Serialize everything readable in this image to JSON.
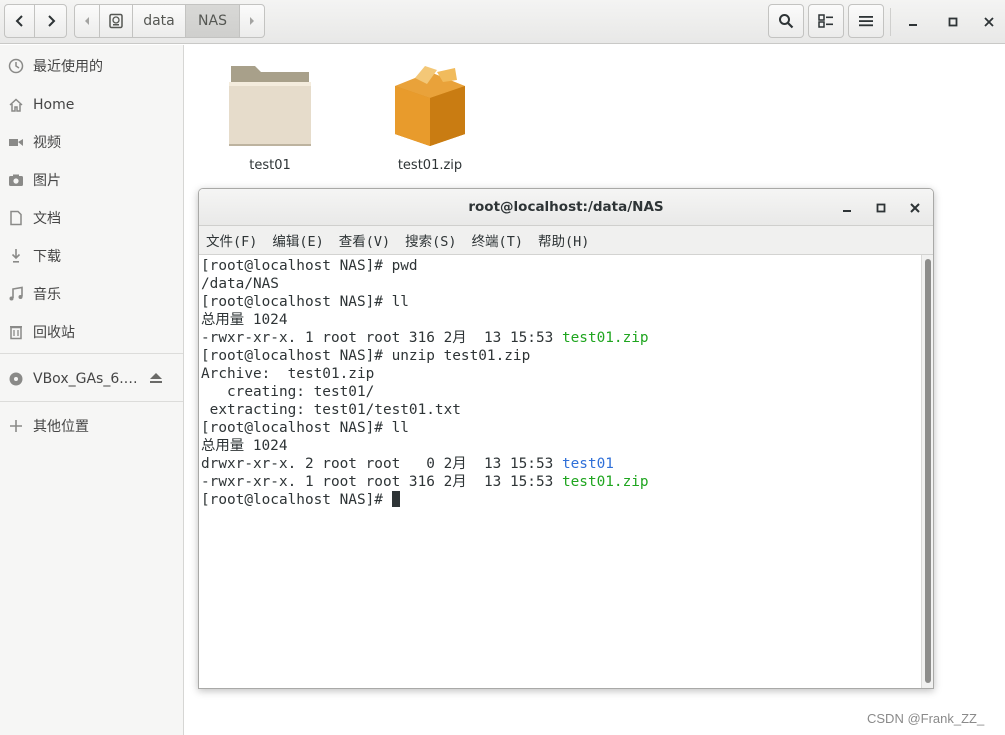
{
  "header": {
    "path_root_icon": "drive-icon",
    "path_segments": [
      "data",
      "NAS"
    ]
  },
  "sidebar": {
    "items": [
      {
        "icon": "clock-icon",
        "label": "最近使用的"
      },
      {
        "icon": "home-icon",
        "label": "Home"
      },
      {
        "icon": "video-icon",
        "label": "视频"
      },
      {
        "icon": "camera-icon",
        "label": "图片"
      },
      {
        "icon": "document-icon",
        "label": "文档"
      },
      {
        "icon": "download-icon",
        "label": "下载"
      },
      {
        "icon": "music-icon",
        "label": "音乐"
      },
      {
        "icon": "trash-icon",
        "label": "回收站"
      },
      {
        "icon": "disc-icon",
        "label": "VBox_GAs_6.…"
      },
      {
        "icon": "plus-icon",
        "label": "其他位置"
      }
    ]
  },
  "files": [
    {
      "name": "test01",
      "icon": "folder-icon"
    },
    {
      "name": "test01.zip",
      "icon": "package-icon"
    }
  ],
  "terminal": {
    "title": "root@localhost:/data/NAS",
    "menu": [
      "文件(F)",
      "编辑(E)",
      "查看(V)",
      "搜索(S)",
      "终端(T)",
      "帮助(H)"
    ],
    "lines": [
      {
        "text": "[root@localhost NAS]# pwd",
        "hl": ""
      },
      {
        "text": "/data/NAS",
        "hl": ""
      },
      {
        "text": "[root@localhost NAS]# ll",
        "hl": ""
      },
      {
        "text": "总用量 1024",
        "hl": ""
      },
      {
        "text": "-rwxr-xr-x. 1 root root 316 2月  13 15:53 ",
        "hl": "test01.zip",
        "hl_color": "green"
      },
      {
        "text": "[root@localhost NAS]# unzip test01.zip",
        "hl": ""
      },
      {
        "text": "Archive:  test01.zip",
        "hl": ""
      },
      {
        "text": "   creating: test01/",
        "hl": ""
      },
      {
        "text": " extracting: test01/test01.txt",
        "hl": ""
      },
      {
        "text": "[root@localhost NAS]# ll",
        "hl": ""
      },
      {
        "text": "总用量 1024",
        "hl": ""
      },
      {
        "text": "drwxr-xr-x. 2 root root   0 2月  13 15:53 ",
        "hl": "test01",
        "hl_color": "blue"
      },
      {
        "text": "-rwxr-xr-x. 1 root root 316 2月  13 15:53 ",
        "hl": "test01.zip",
        "hl_color": "green"
      },
      {
        "text": "[root@localhost NAS]# ",
        "hl": "",
        "cursor": true
      }
    ]
  },
  "watermark": "CSDN @Frank_ZZ_",
  "colors": {
    "green_text": "#1fa51f",
    "blue_text": "#2f6fd8",
    "terminal_fg": "#2e3436"
  }
}
